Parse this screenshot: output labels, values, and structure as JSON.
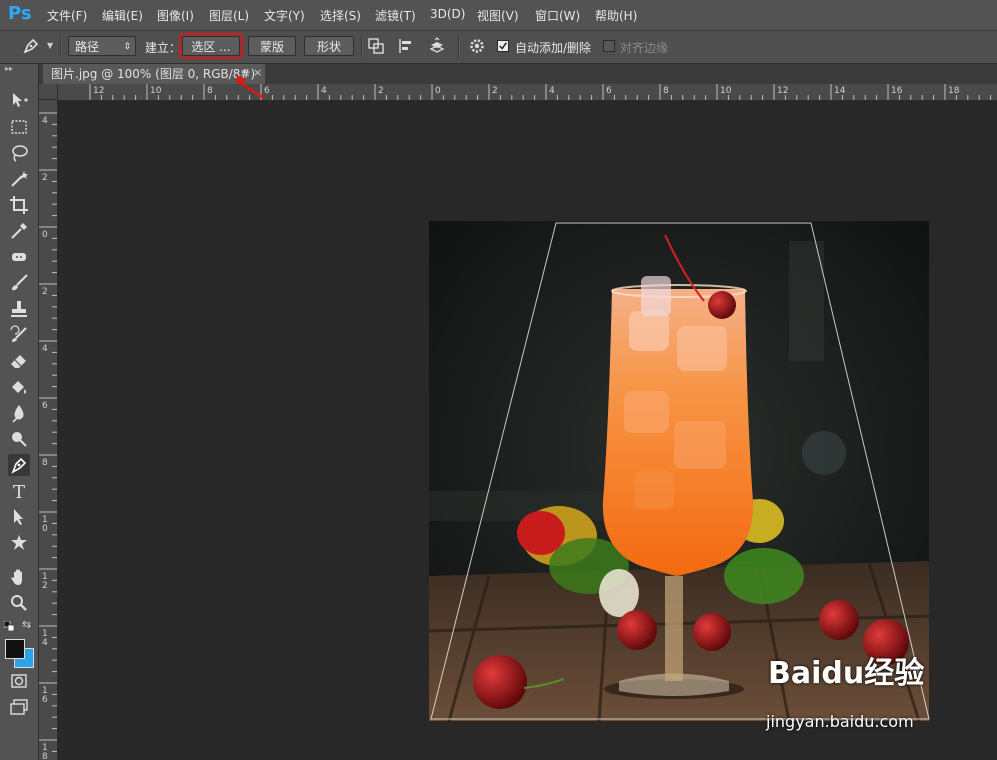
{
  "app": {
    "logo": "Ps"
  },
  "menu": [
    "文件(F)",
    "编辑(E)",
    "图像(I)",
    "图层(L)",
    "文字(Y)",
    "选择(S)",
    "滤镜(T)",
    "3D(D)",
    "视图(V)",
    "窗口(W)",
    "帮助(H)"
  ],
  "options": {
    "mode_value": "路径",
    "make_label": "建立：",
    "selection_button": "选区 ...",
    "mask_button": "蒙版",
    "shape_button": "形状",
    "auto_add_delete": "自动添加/删除",
    "align_edges": "对齐边缘"
  },
  "document": {
    "tab_title": "图片.jpg @ 100% (图层 0, RGB/8#)",
    "tab_modified": "*",
    "tab_close": "×"
  },
  "rulers": {
    "horizontal": [
      "12",
      "10",
      "8",
      "6",
      "4",
      "2",
      "0",
      "2",
      "4",
      "6",
      "8",
      "10",
      "12",
      "14",
      "16",
      "18"
    ],
    "vertical": [
      "4",
      "2",
      "0",
      "2",
      "4",
      "6",
      "8",
      "10",
      "12",
      "14",
      "16",
      "18"
    ]
  },
  "watermark": {
    "brand": "Baidu经验",
    "url": "jingyan.baidu.com"
  },
  "colors": {
    "accent": "#31a8ff",
    "highlight": "#e01515"
  }
}
